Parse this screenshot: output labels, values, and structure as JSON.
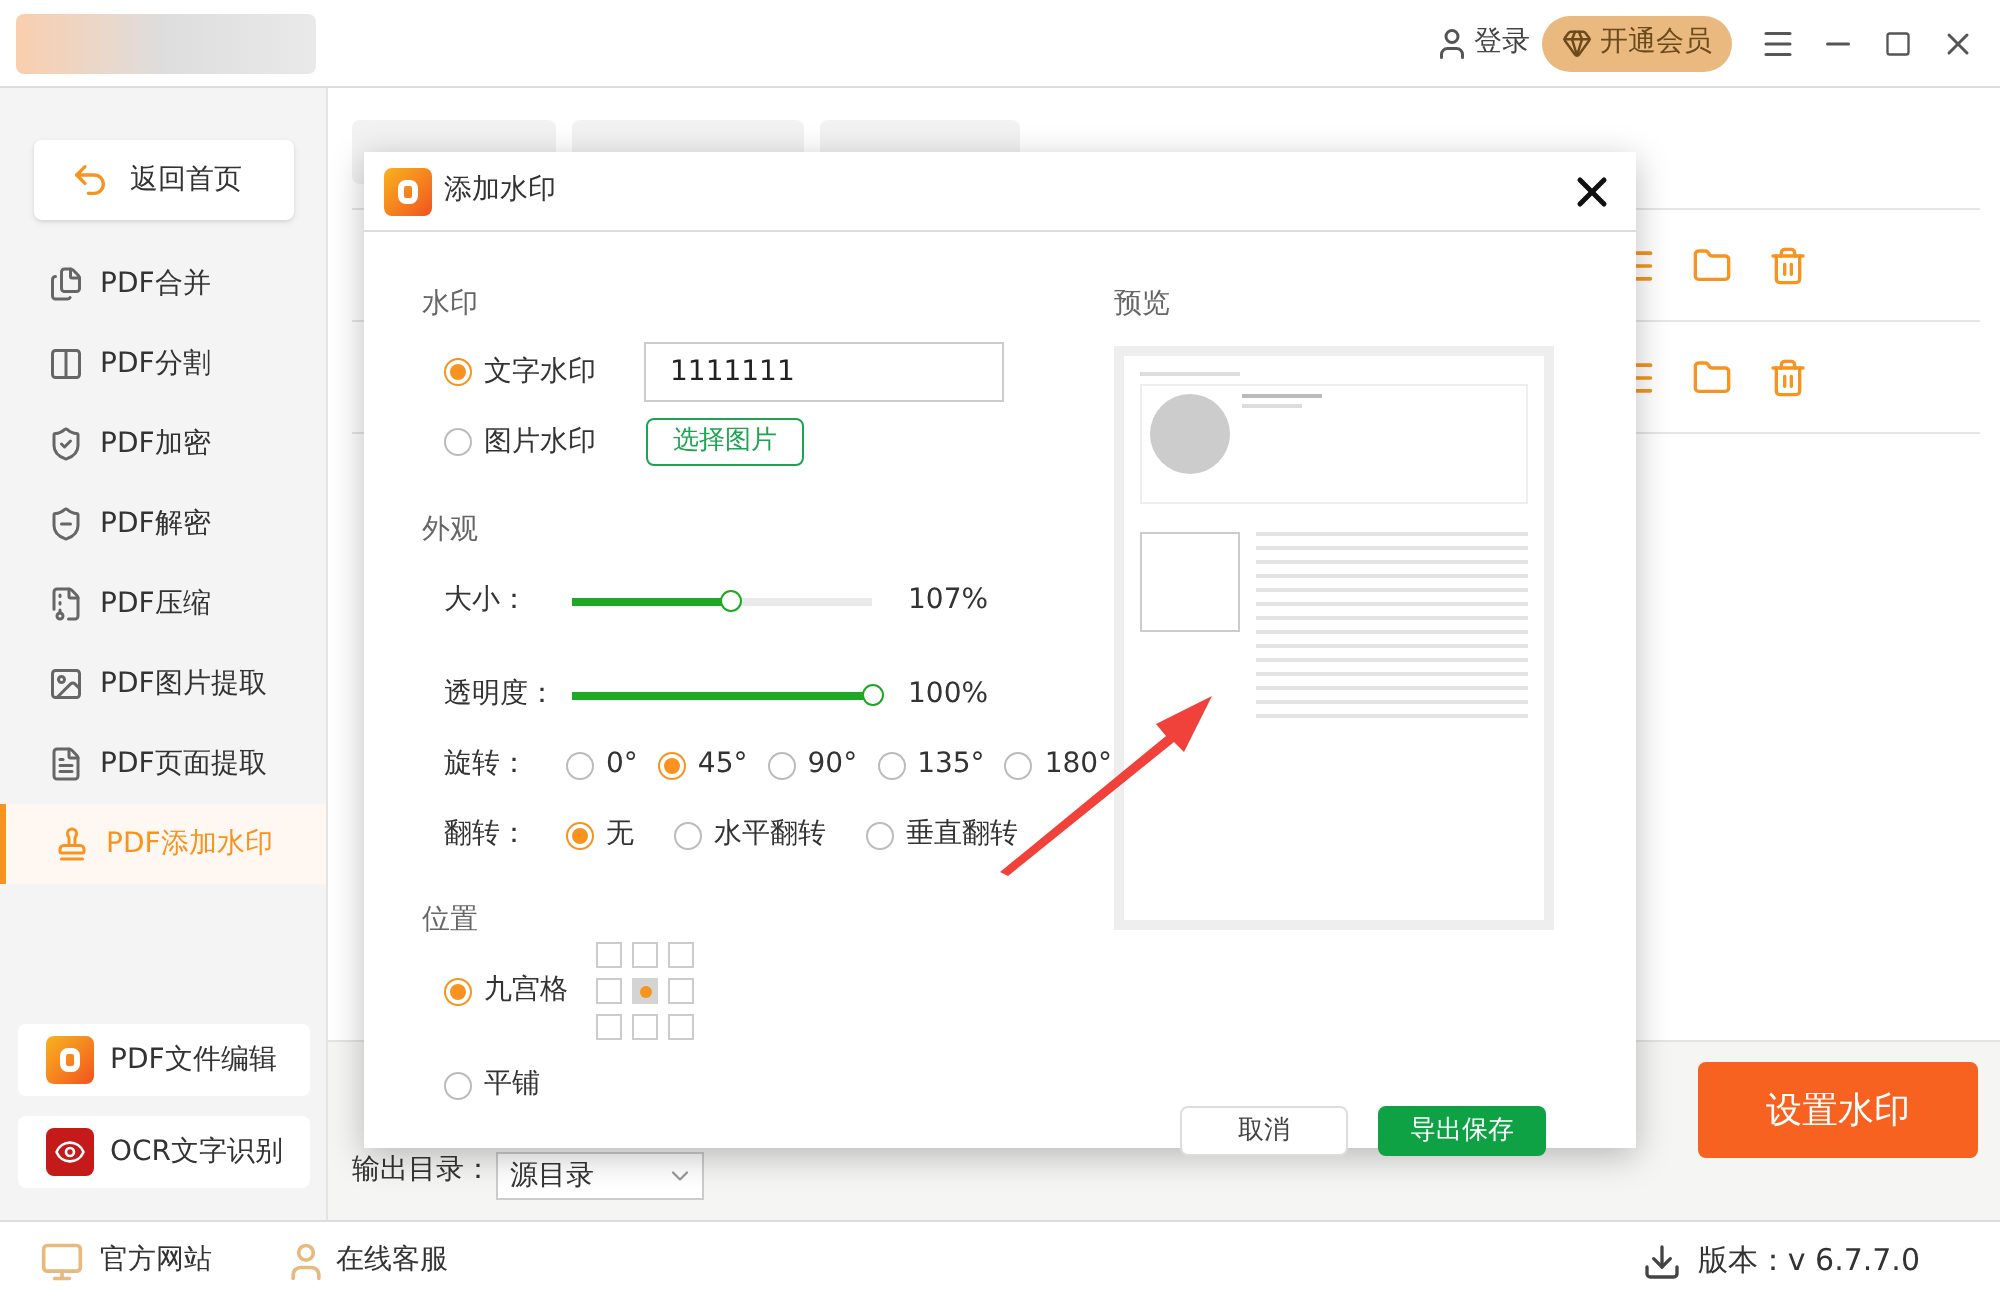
{
  "header": {
    "login": "登录",
    "vip": "开通会员"
  },
  "sidebar": {
    "back": "返回首页",
    "items": [
      {
        "label": "PDF合并",
        "selected": false,
        "kind": "merge"
      },
      {
        "label": "PDF分割",
        "selected": false,
        "kind": "split"
      },
      {
        "label": "PDF加密",
        "selected": false,
        "kind": "encrypt"
      },
      {
        "label": "PDF解密",
        "selected": false,
        "kind": "decrypt"
      },
      {
        "label": "PDF压缩",
        "selected": false,
        "kind": "compress"
      },
      {
        "label": "PDF图片提取",
        "selected": false,
        "kind": "image"
      },
      {
        "label": "PDF页面提取",
        "selected": false,
        "kind": "page"
      },
      {
        "label": "PDF添加水印",
        "selected": true,
        "kind": "watermark"
      }
    ],
    "tools": [
      {
        "label": "PDF文件编辑",
        "kind": "edit"
      },
      {
        "label": "OCR文字识别",
        "kind": "ocr"
      }
    ]
  },
  "output": {
    "label": "输出目录：",
    "value": "源目录"
  },
  "action_button": "设置水印",
  "dialog": {
    "title": "添加水印",
    "watermark": {
      "heading": "水印",
      "types": [
        {
          "label": "文字水印",
          "selected": true,
          "kind": "text"
        },
        {
          "label": "图片水印",
          "selected": false,
          "kind": "image"
        }
      ],
      "text_value": "1111111",
      "choose_image": "选择图片"
    },
    "appearance": {
      "heading": "外观",
      "sliders": [
        {
          "label": "大小：",
          "level": 0.53,
          "reading": "107%"
        },
        {
          "label": "透明度：",
          "level": 1,
          "reading": "100%"
        }
      ],
      "rotation": {
        "label": "旋转：",
        "options": [
          {
            "label": "0°",
            "selected": false
          },
          {
            "label": "45°",
            "selected": true
          },
          {
            "label": "90°",
            "selected": false
          },
          {
            "label": "135°",
            "selected": false
          },
          {
            "label": "180°",
            "selected": false
          }
        ]
      },
      "flip": {
        "label": "翻转：",
        "options": [
          {
            "label": "无",
            "selected": true
          },
          {
            "label": "水平翻转",
            "selected": false
          },
          {
            "label": "垂直翻转",
            "selected": false
          }
        ]
      }
    },
    "position": {
      "heading": "位置",
      "modes": [
        {
          "label": "九宫格",
          "selected": true,
          "kind": "grid"
        },
        {
          "label": "平铺",
          "selected": false,
          "kind": "tile"
        }
      ],
      "grid": [
        {
          "selected": false
        },
        {
          "selected": false
        },
        {
          "selected": false
        },
        {
          "selected": false
        },
        {
          "selected": true
        },
        {
          "selected": false
        },
        {
          "selected": false
        },
        {
          "selected": false
        },
        {
          "selected": false
        }
      ]
    },
    "preview": {
      "heading": "预览"
    },
    "buttons": [
      {
        "label": "取消",
        "kind": "secondary"
      },
      {
        "label": "导出保存",
        "kind": "primary"
      }
    ]
  },
  "status_bar": {
    "website": "官方网站",
    "support": "在线客服",
    "version": "版本：v 6.7.7.0"
  }
}
